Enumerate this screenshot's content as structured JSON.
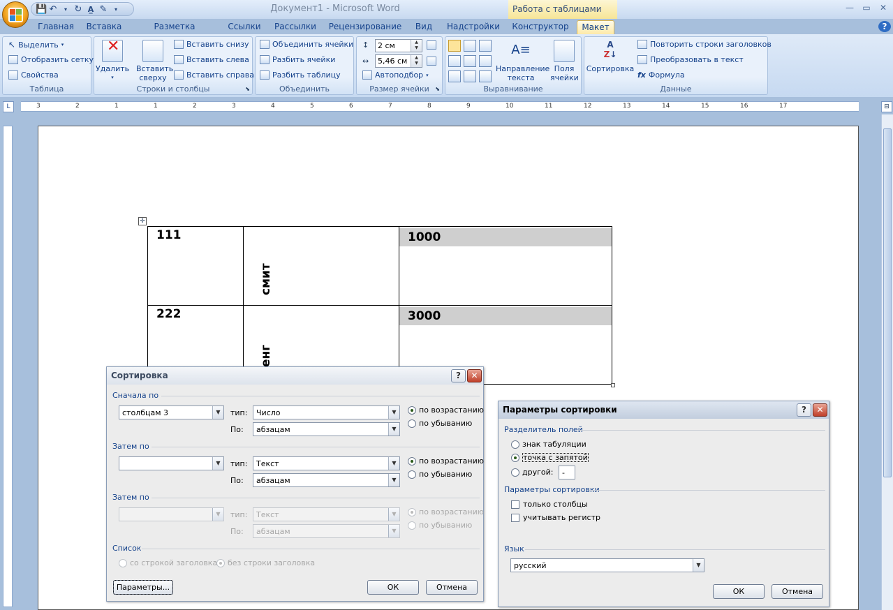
{
  "title_bar": {
    "document_title": "Документ1 - Microsoft Word",
    "context_title": "Работа с таблицами"
  },
  "tabs": [
    "Главная",
    "Вставка",
    "Разметка страницы",
    "Ссылки",
    "Рассылки",
    "Рецензирование",
    "Вид",
    "Надстройки",
    "Конструктор",
    "Макет"
  ],
  "ribbon": {
    "table_group": {
      "label": "Таблица",
      "select": "Выделить",
      "grid": "Отобразить сетку",
      "properties": "Свойства"
    },
    "rows_cols_group": {
      "label": "Строки и столбцы",
      "delete": "Удалить",
      "insert_above": "Вставить сверху",
      "insert_below": "Вставить снизу",
      "insert_left": "Вставить слева",
      "insert_right": "Вставить справа"
    },
    "merge_group": {
      "label": "Объединить",
      "merge": "Объединить ячейки",
      "split_cells": "Разбить ячейки",
      "split_table": "Разбить таблицу"
    },
    "cell_size_group": {
      "label": "Размер ячейки",
      "height": "2 см",
      "width": "5,46 см",
      "autofit": "Автоподбор"
    },
    "align_group": {
      "label": "Выравнивание",
      "direction": "Направление текста",
      "margins": "Поля ячейки"
    },
    "data_group": {
      "label": "Данные",
      "sort": "Сортировка",
      "repeat_header": "Повторить строки заголовков",
      "to_text": "Преобразовать в текст",
      "formula": "Формула"
    }
  },
  "ruler": {
    "numbers": [
      "3",
      "2",
      "1",
      "1",
      "2",
      "3",
      "4",
      "5",
      "6",
      "7",
      "8",
      "9",
      "10",
      "11",
      "12",
      "13",
      "14",
      "15",
      "16",
      "17"
    ]
  },
  "document_table": [
    {
      "c1": "111",
      "c2": "смит",
      "c3": "1000"
    },
    {
      "c1": "222",
      "c2": "енг",
      "c3": "3000"
    }
  ],
  "sort_dialog": {
    "title": "Сортировка",
    "first_by": "Сначала по",
    "then_by": "Затем по",
    "then_by2": "Затем по",
    "list": "Список",
    "type_label": "тип:",
    "by_label": "По:",
    "row1": {
      "column": "столбцам 3",
      "type": "Число",
      "by": "абзацам",
      "asc": "по возрастанию",
      "desc": "по убыванию"
    },
    "row2": {
      "column": "",
      "type": "Текст",
      "by": "абзацам",
      "asc": "по возрастанию",
      "desc": "по убыванию"
    },
    "row3": {
      "column": "",
      "type": "Текст",
      "by": "абзацам",
      "asc": "по возрастанию",
      "desc": "по убыванию"
    },
    "with_header": "со строкой заголовка",
    "without_header": "без строки заголовка",
    "params_btn": "Параметры...",
    "ok": "ОК",
    "cancel": "Отмена"
  },
  "params_dialog": {
    "title": "Параметры сортировки",
    "separator_section": "Разделитель полей",
    "tab": "знак табуляции",
    "semicolon": "точка с запятой",
    "other": "другой:",
    "other_value": "-",
    "sort_params_section": "Параметры сортировки",
    "only_columns": "только столбцы",
    "case_sensitive": "учитывать регистр",
    "language_section": "Язык",
    "language": "русский",
    "ok": "ОК",
    "cancel": "Отмена"
  }
}
